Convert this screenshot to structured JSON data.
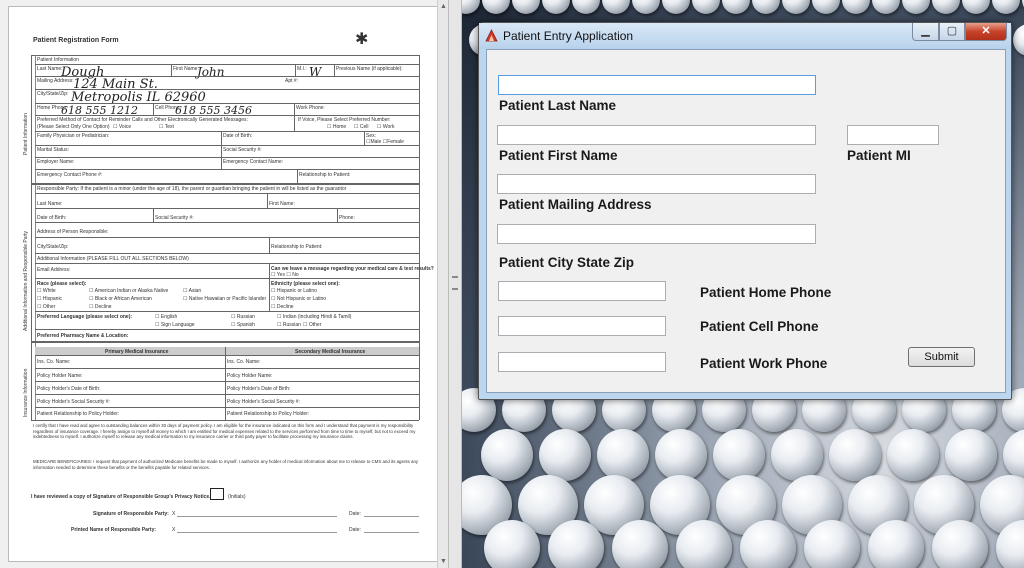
{
  "document": {
    "title": "Patient Registration Form",
    "section_patient_info": "Patient Information",
    "last_name_label": "Last Name:",
    "first_name_label": "First Name:",
    "mi_label": "M.I.:",
    "previous_name_label": "Previous Name (if applicable):",
    "mailing_address_label": "Mailing Address:",
    "apt_label": "Apt #:",
    "city_state_zip_label": "City/State/Zip:",
    "home_phone_label": "Home Phone:",
    "cell_phone_label": "Cell Phone:",
    "work_phone_label": "Work Phone:",
    "preferred_method_label": "Preferred Method of Contact for Reminder Calls and Other Electronically Generated Messages:",
    "select_one_label": "(Please Select Only One Option)",
    "voice_label": "Voice",
    "text_label": "Text",
    "if_voice_label": "If Voice, Please Select Preferred Number:",
    "home_opt": "Home",
    "cell_opt": "Cell",
    "work_opt": "Work",
    "family_physician_label": "Family Physician or Pediatrician:",
    "dob_label": "Date of Birth:",
    "sex_label": "Sex:",
    "male_opt": "Male",
    "female_opt": "Female",
    "marital_label": "Marital Status:",
    "ssn_label": "Social Security #:",
    "employer_label": "Employer Name:",
    "emergency_contact_label": "Emergency Contact Name:",
    "emergency_phone_label": "Emergency Contact Phone #:",
    "relationship_label": "Relationship to Patient:",
    "side_patient_info": "Patient Information",
    "responsible_party_header": "Responsible Party: If the patient is a minor (under the age of 18), the parent or guardian bringing the patient in will be listed as the guarantor",
    "rp_last_name": "Last Name:",
    "rp_first_name": "First Name:",
    "rp_dob": "Date of Birth:",
    "rp_ssn": "Social Security #:",
    "rp_phone": "Phone:",
    "rp_address": "Address of Person Responsible:",
    "rp_city": "City/State/Zip:",
    "rp_relationship": "Relationship to Patient:",
    "side_additional": "Additional Information and Responsible Party",
    "additional_header": "Additional Information (PLEASE FILL OUT ALL SECTIONS BELOW)",
    "email_label": "Email Address:",
    "message_question": "Can we leave a message regarding your medical care & test results?",
    "yes_opt": "Yes",
    "no_opt": "No",
    "race_label": "Race (please select):",
    "race_opts": [
      "White",
      "American Indian or Alaska Native",
      "Asian",
      "Hispanic",
      "Black or African American",
      "Native Hawaiian or Pacific Islander",
      "Other",
      "Decline"
    ],
    "ethnicity_label": "Ethnicity (please select one):",
    "ethnicity_opts": [
      "Hispanic or Latino",
      "Not Hispanic or Latino",
      "Decline"
    ],
    "language_label": "Preferred Language (please select one):",
    "language_opts": [
      "English",
      "Russian",
      "Indian (including Hindi & Tamil)",
      "Sign Language",
      "Spanish",
      "Russian",
      "Other"
    ],
    "pharmacy_label": "Preferred Pharmacy Name & Location:",
    "primary_ins": "Primary Medical Insurance",
    "secondary_ins": "Secondary Medical Insurance",
    "ins_co_name": "Ins. Co. Name:",
    "policy_holder_name": "Policy Holder Name:",
    "policy_holder_dob": "Policy Holder's Date of Birth:",
    "policy_holder_ssn": "Policy Holder's Social Security #:",
    "patient_relationship": "Patient Relationship to Policy Holder:",
    "side_insurance": "Insurance Information",
    "consent_text": "I certify that I have read and agree to outstanding balances within 30 days of payment policy. I am eligible for the insurance indicated on this form and I understand that payment is my responsibility regardless of insurance coverage. I hereby assign to myself all money to which I am entitled for medical expenses related to the services performed from time to time to myself, but not to exceed my indebtedness to myself. I authorize myself to release any medical information to my insurance carrier or third party payer to facilitate processing my insurance claims.",
    "medicare_text": "MEDICARE BENEFICIARIES: I request that payment of authorized Medicare benefits be made to myself. I authorize any holder of medical information about me to release to CMS and its agents any information needed to determine these benefits or the benefits payable for related services.",
    "privacy_notice": "I have reviewed a copy of Signature of Responsible Group's Privacy Notice.",
    "initials": "(Initials)",
    "signature_label": "Signature of Responsible Party:",
    "printed_name_label": "Printed Name of Responsible Party:",
    "x_mark": "X",
    "date_label": "Date:",
    "hw_last": "Dough",
    "hw_first": "John",
    "hw_mi": "W",
    "hw_address": "124 Main St.",
    "hw_city": "Metropolis  IL   62960",
    "hw_home": "618 555 1212",
    "hw_cell": "618 555 3456"
  },
  "window": {
    "title": "Patient Entry Application",
    "labels": {
      "last_name": "Patient Last Name",
      "first_name": "Patient First Name",
      "mi": "Patient MI",
      "mailing": "Patient Mailing Address",
      "city": "Patient City State Zip",
      "home_phone": "Patient Home Phone",
      "cell_phone": "Patient Cell Phone",
      "work_phone": "Patient Work Phone"
    },
    "fields": {
      "last_name": "",
      "first_name": "",
      "mi": "",
      "mailing": "",
      "city": "",
      "home_phone": "",
      "cell_phone": "",
      "work_phone": ""
    },
    "submit_label": "Submit",
    "min_glyph": "▁",
    "max_glyph": "▢",
    "close_glyph": "✕"
  }
}
